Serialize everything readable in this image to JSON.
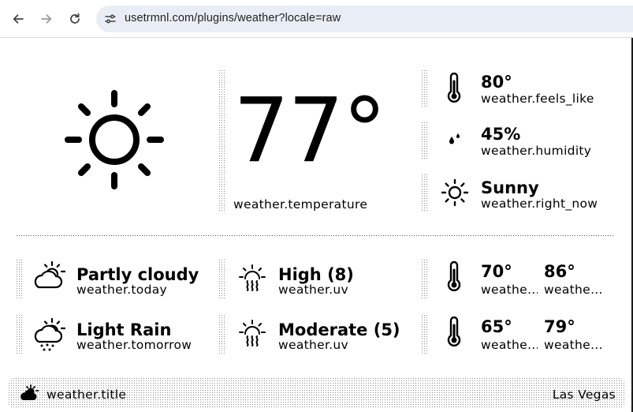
{
  "browser": {
    "url": "usetrmnl.com/plugins/weather?locale=raw"
  },
  "current": {
    "temperature": "77°",
    "temperature_label": "weather.temperature",
    "feels_like": "80°",
    "feels_like_label": "weather.feels_like",
    "humidity": "45%",
    "humidity_label": "weather.humidity",
    "condition": "Sunny",
    "condition_label": "weather.right_now"
  },
  "forecast": [
    {
      "condition": "Partly cloudy",
      "condition_label": "weather.today",
      "uv": "High (8)",
      "uv_label": "weather.uv",
      "low": "70°",
      "low_label": "weathe…",
      "high": "86°",
      "high_label": "weathe…"
    },
    {
      "condition": "Light Rain",
      "condition_label": "weather.tomorrow",
      "uv": "Moderate (5)",
      "uv_label": "weather.uv",
      "low": "65°",
      "low_label": "weathe…",
      "high": "79°",
      "high_label": "weathe…"
    }
  ],
  "footer": {
    "title": "weather.title",
    "location": "Las Vegas"
  },
  "icons": {
    "back": "arrow-left-icon",
    "forward": "arrow-right-icon",
    "reload": "reload-icon",
    "site_settings": "tune-icon",
    "main_weather": "sun-icon",
    "feels_like": "thermometer-icon",
    "humidity": "droplets-icon",
    "condition": "sun-icon",
    "today": "partly-cloudy-icon",
    "tomorrow": "light-rain-icon",
    "uv": "uv-sun-icon",
    "temp_range": "thermometer-icon",
    "footer": "sun-cloud-icon"
  }
}
